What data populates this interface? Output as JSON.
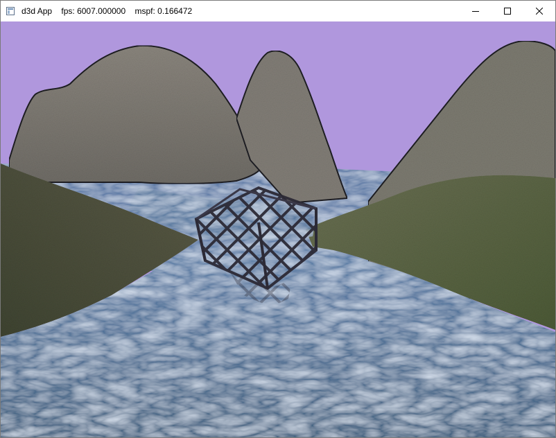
{
  "window": {
    "app_name": "d3d App",
    "fps_text": "fps: 6007.000000",
    "mspf_text": "mspf: 0.166472"
  },
  "caption_buttons": {
    "minimize_icon": "minimize-icon",
    "maximize_icon": "maximize-icon",
    "close_icon": "close-icon"
  },
  "scene": {
    "sky_color": "#b097dd",
    "hill_color": "#77746e",
    "grass_color": "#58603f",
    "water_color": "#4a6a8f",
    "crate_color": "#2e2c38"
  }
}
